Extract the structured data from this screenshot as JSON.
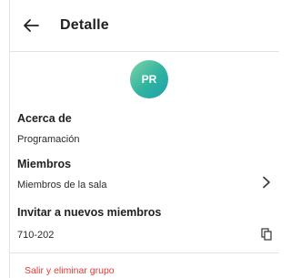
{
  "header": {
    "back_icon": "arrow-left-icon",
    "title": "Detalle"
  },
  "avatar": {
    "initials": "PR",
    "gradient_start": "#7fd3a6",
    "gradient_end": "#1f9fae"
  },
  "sections": {
    "about": {
      "title": "Acerca de",
      "value": "Programación"
    },
    "members": {
      "title": "Miembros",
      "value": "Miembros de la sala",
      "action_icon": "chevron-right-icon"
    },
    "invite": {
      "title": "Invitar a nuevos miembros",
      "value": "710-202",
      "action_icon": "copy-icon"
    }
  },
  "footer": {
    "exit_label": "Salir y eliminar grupo",
    "exit_color": "#e53935"
  }
}
